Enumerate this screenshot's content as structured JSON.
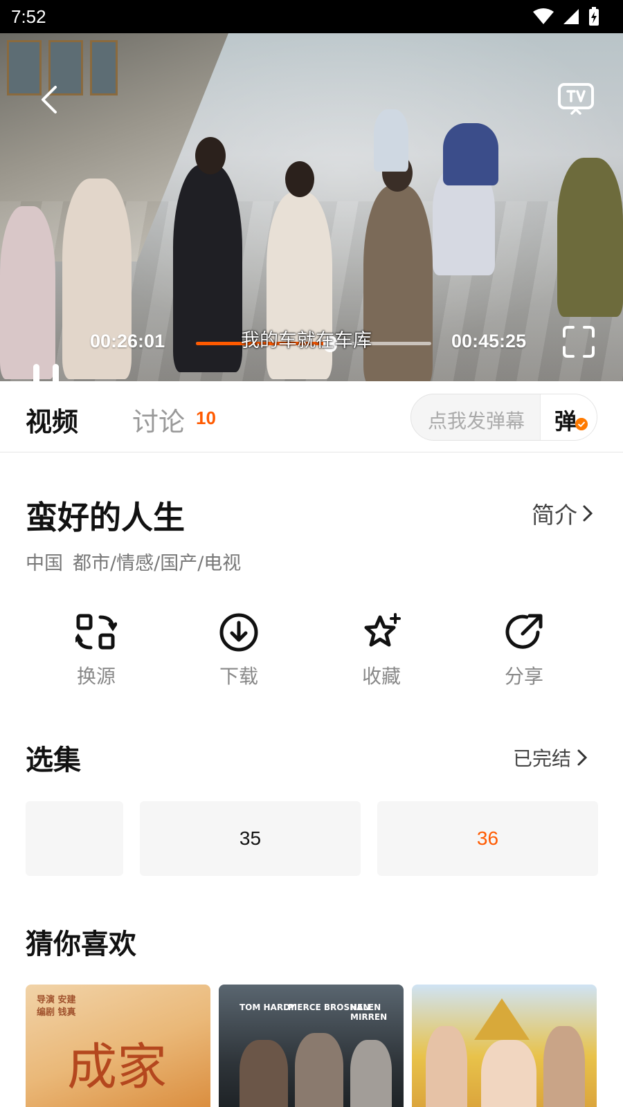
{
  "status_bar": {
    "time": "7:52"
  },
  "player": {
    "current_time": "00:26:01",
    "total_time": "00:45:25",
    "progress": 0.57,
    "subtitle": "我的车就在车库"
  },
  "tabs": {
    "video_label": "视频",
    "discuss_label": "讨论",
    "discuss_count": "10",
    "danmaku_placeholder": "点我发弹幕",
    "danmaku_toggle": "弹"
  },
  "show": {
    "title": "蛮好的人生",
    "intro_label": "简介",
    "country": "中国",
    "genres": "都市/情感/国产/电视"
  },
  "actions": [
    {
      "label": "换源",
      "icon": "switch-source-icon"
    },
    {
      "label": "下载",
      "icon": "download-icon"
    },
    {
      "label": "收藏",
      "icon": "favorite-star-icon"
    },
    {
      "label": "分享",
      "icon": "share-icon"
    }
  ],
  "episodes": {
    "title": "选集",
    "status_label": "已完结",
    "items": [
      {
        "label": ""
      },
      {
        "label": "35"
      },
      {
        "label": "36",
        "selected": true
      }
    ]
  },
  "recommend": {
    "title": "猜你喜欢",
    "posters": [
      {
        "text_main": "成家",
        "text_small": "导演 安建  编剧 钱真"
      },
      {
        "names": [
          "TOM HARDY",
          "PIERCE BROSNAN",
          "HELEN MIRREN"
        ]
      },
      {
        "text_main": ""
      }
    ]
  },
  "colors": {
    "accent": "#ff5a00"
  }
}
